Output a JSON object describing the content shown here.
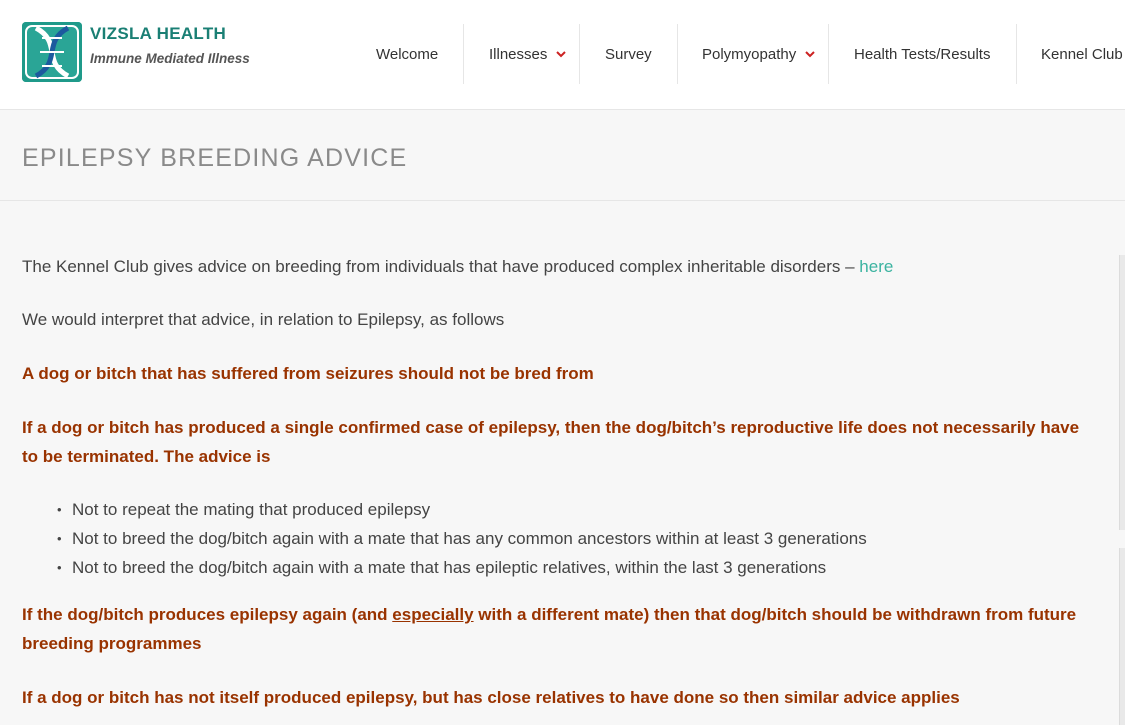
{
  "brand": {
    "title": "VIZSLA HEALTH",
    "subtitle": "Immune Mediated Illness",
    "logo_icon": "dna-helix-icon"
  },
  "nav": {
    "items": [
      {
        "label": "Welcome",
        "has_dropdown": false
      },
      {
        "label": "Illnesses",
        "has_dropdown": true
      },
      {
        "label": "Survey",
        "has_dropdown": false
      },
      {
        "label": "Polymyopathy",
        "has_dropdown": true
      },
      {
        "label": "Health Tests/Results",
        "has_dropdown": false
      },
      {
        "label": "Kennel Club",
        "has_dropdown": false
      }
    ],
    "dropdown_icon_color": "#cc2222"
  },
  "page": {
    "title": "EPILEPSY BREEDING ADVICE"
  },
  "content": {
    "intro_text": "The Kennel Club gives advice on breeding from individuals that have produced complex inheritable disorders –",
    "intro_link": "here",
    "interpret": "We would interpret that advice, in relation to Epilepsy, as follows",
    "rule1": "A dog or bitch that has suffered from seizures should not be bred from",
    "rule2": "If a dog or bitch has produced a single confirmed case of epilepsy, then the dog/bitch’s reproductive life does not necessarily have to be terminated. The advice is",
    "bullets": [
      "Not to repeat the mating that produced epilepsy",
      "Not to breed the dog/bitch again with a mate that has any common ancestors within at least 3 generations",
      "Not to breed the dog/bitch again with a mate that has epileptic relatives, within the last 3 generations"
    ],
    "rule3_a": "If the dog/bitch produces epilepsy again (and",
    "rule3_emph": "especially",
    "rule3_b": "with a different mate) then that dog/bitch should be withdrawn from future breeding programmes",
    "rule4": "If a dog or bitch has not itself produced epilepsy, but has close relatives to have done so then similar advice applies"
  },
  "colors": {
    "accent_teal": "#3bb3a0",
    "warning_red": "#993300",
    "title_gray": "#8a8a8a"
  }
}
